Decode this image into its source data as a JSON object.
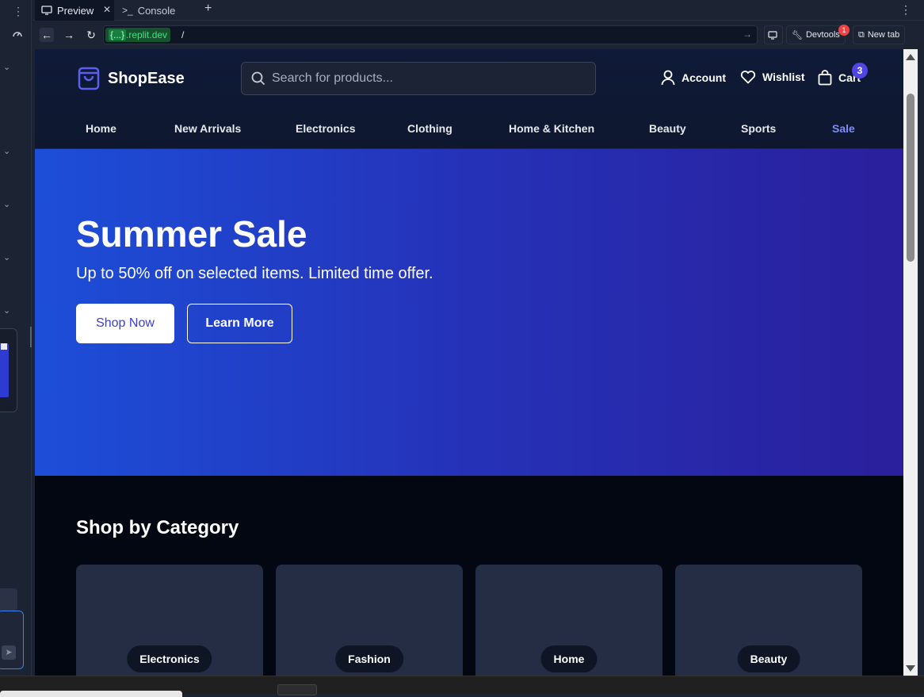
{
  "browser": {
    "tabs": [
      {
        "label": "Preview"
      },
      {
        "label": "Console"
      }
    ],
    "url_domain_template": "{...}",
    "url_domain": ".replit.dev",
    "url_path": "/",
    "devtools_label": "Devtools",
    "devtools_badge": "1",
    "newtab_label": "New tab"
  },
  "site": {
    "brand": "ShopEase",
    "search_placeholder": "Search for products...",
    "header_links": {
      "account": "Account",
      "wishlist": "Wishlist",
      "cart": "Cart",
      "cart_count": "3"
    },
    "nav": [
      "Home",
      "New Arrivals",
      "Electronics",
      "Clothing",
      "Home & Kitchen",
      "Beauty",
      "Sports",
      "Sale"
    ],
    "hero": {
      "title": "Summer Sale",
      "subtitle": "Up to 50% off on selected items. Limited time offer.",
      "primary_cta": "Shop Now",
      "secondary_cta": "Learn More"
    },
    "categories": {
      "heading": "Shop by Category",
      "items": [
        "Electronics",
        "Fashion",
        "Home",
        "Beauty"
      ]
    }
  },
  "colors": {
    "accent": "#4f46e5",
    "sale_link": "#818cf8",
    "hero_start": "#1d4ed8",
    "hero_end": "#2a1f9c"
  },
  "icons": [
    "shopping-bag-icon",
    "search-icon",
    "user-icon",
    "heart-icon",
    "cart-icon",
    "monitor-icon",
    "console-icon",
    "back-arrow-icon",
    "forward-arrow-icon",
    "reload-icon",
    "wrench-icon",
    "external-link-icon"
  ]
}
